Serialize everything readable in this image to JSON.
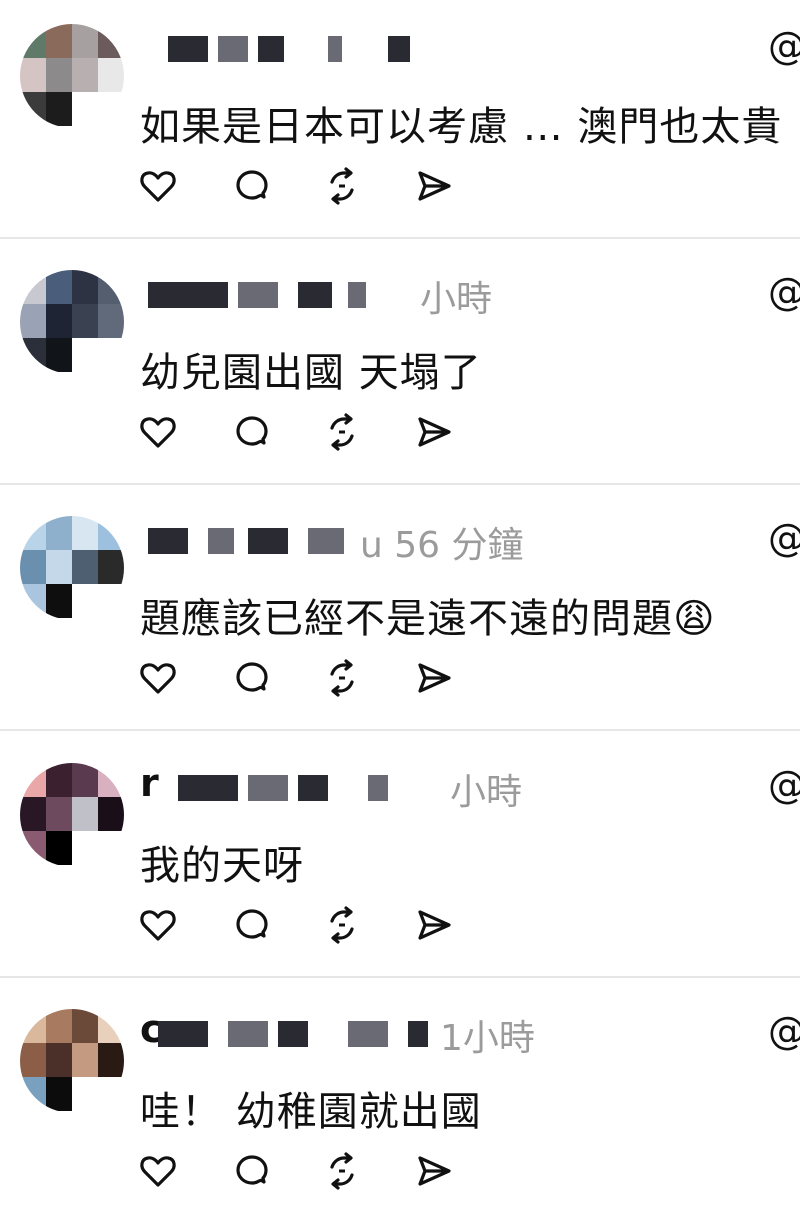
{
  "comments": [
    {
      "text": "如果是日本可以考慮 … 澳門也太貴",
      "meta": "",
      "handle_prefix": "",
      "more": "@",
      "avatar_colors": [
        "#5f7a68",
        "#8a6a5a",
        "#a7a0a0",
        "#6b5b5b",
        "#d5c4c4",
        "#8c8a8a",
        "#b8b0b0",
        "#e8e8e8",
        "#3b3b3b",
        "#1c1c1c"
      ]
    },
    {
      "text": "幼兒園出國 天塌了",
      "meta": "小時",
      "handle_prefix": "",
      "more": "@",
      "avatar_colors": [
        "#c8c8d0",
        "#4a5d7a",
        "#2e3344",
        "#545e6e",
        "#9aa3b5",
        "#1e2433",
        "#3a4150",
        "#606a7a",
        "#2a2f3a",
        "#111418"
      ]
    },
    {
      "text": "題應該已經不是遠不遠的問題😩",
      "meta": "u 56 分鐘",
      "handle_prefix": "",
      "more": "@",
      "avatar_colors": [
        "#b9d3e8",
        "#8fb0cc",
        "#d8e6f2",
        "#9cc0dd",
        "#6a8faf",
        "#c4d8ea",
        "#4d5f70",
        "#2a2a2a",
        "#a9c5df",
        "#0e0e0e"
      ]
    },
    {
      "text": "我的天呀",
      "meta": "小時",
      "handle_prefix": "r",
      "more": "@",
      "avatar_colors": [
        "#e9a7a7",
        "#3b2030",
        "#5a3a4e",
        "#d8b0c0",
        "#2a1726",
        "#6e4a5e",
        "#c0c0c8",
        "#1a0f18",
        "#8a5a70",
        "#000000"
      ]
    },
    {
      "text": "哇！ 幼稚園就出國",
      "meta": "1小時",
      "handle_prefix": "c",
      "more": "@",
      "avatar_colors": [
        "#d9b89c",
        "#a87a60",
        "#6b4a3a",
        "#e8d0bc",
        "#8c5e48",
        "#4a3028",
        "#c49a80",
        "#2a1a14",
        "#7aa0c0",
        "#0c0c0c"
      ]
    }
  ],
  "action_icons": [
    "heart-icon",
    "comment-icon",
    "repost-icon",
    "share-icon"
  ]
}
